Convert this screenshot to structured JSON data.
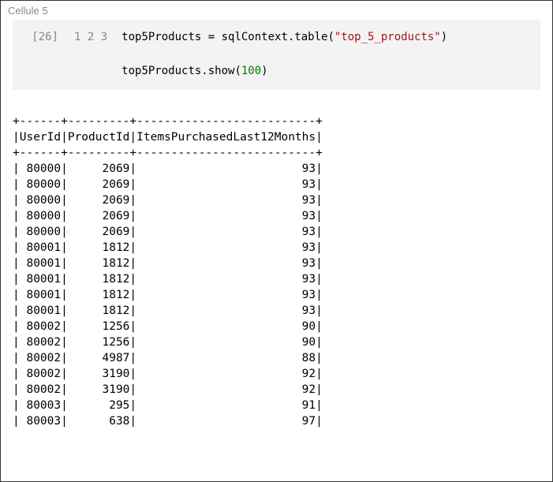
{
  "cell_label": "Cellule 5",
  "exec_count": "[26]",
  "line_numbers": [
    "1",
    "2",
    "3"
  ],
  "code": {
    "line1_pre": "top5Products = sqlContext.table(",
    "line1_str": "\"top_5_products\"",
    "line1_post": ")",
    "line2": "",
    "line3_pre": "top5Products.show(",
    "line3_num": "100",
    "line3_post": ")"
  },
  "output": {
    "border": "+------+---------+--------------------------+",
    "header": "|UserId|ProductId|ItemsPurchasedLast12Months|",
    "rows": [
      {
        "uid": "80000",
        "pid": "2069",
        "items": "93"
      },
      {
        "uid": "80000",
        "pid": "2069",
        "items": "93"
      },
      {
        "uid": "80000",
        "pid": "2069",
        "items": "93"
      },
      {
        "uid": "80000",
        "pid": "2069",
        "items": "93"
      },
      {
        "uid": "80000",
        "pid": "2069",
        "items": "93"
      },
      {
        "uid": "80001",
        "pid": "1812",
        "items": "93"
      },
      {
        "uid": "80001",
        "pid": "1812",
        "items": "93"
      },
      {
        "uid": "80001",
        "pid": "1812",
        "items": "93"
      },
      {
        "uid": "80001",
        "pid": "1812",
        "items": "93"
      },
      {
        "uid": "80001",
        "pid": "1812",
        "items": "93"
      },
      {
        "uid": "80002",
        "pid": "1256",
        "items": "90"
      },
      {
        "uid": "80002",
        "pid": "1256",
        "items": "90"
      },
      {
        "uid": "80002",
        "pid": "4987",
        "items": "88"
      },
      {
        "uid": "80002",
        "pid": "3190",
        "items": "92"
      },
      {
        "uid": "80002",
        "pid": "3190",
        "items": "92"
      },
      {
        "uid": "80003",
        "pid": "295",
        "items": "91"
      },
      {
        "uid": "80003",
        "pid": "638",
        "items": "97"
      }
    ]
  }
}
